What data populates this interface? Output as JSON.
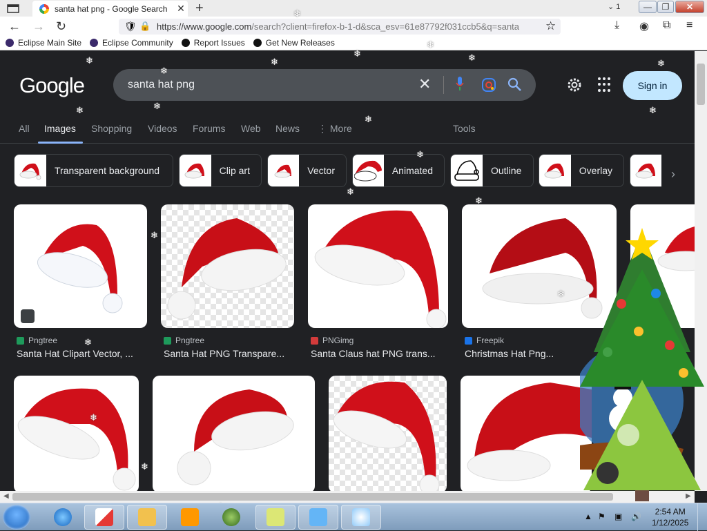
{
  "browser": {
    "tab_title": "santa hat png - Google Search",
    "tab_close": "✕",
    "new_tab": "+",
    "tab_count": "1",
    "url_prefix": "https://www.google.com",
    "url_rest": "/search?client=firefox-b-1-d&sca_esv=61e87792f031ccb5&q=santa",
    "window_buttons": [
      "—",
      "❐",
      "✕"
    ]
  },
  "bookmarks": [
    {
      "label": "Eclipse Main Site",
      "color": "#3b2a6b"
    },
    {
      "label": "Eclipse Community",
      "color": "#3b2a6b"
    },
    {
      "label": "Report Issues",
      "color": "#111111"
    },
    {
      "label": "Get New Releases",
      "color": "#111111"
    }
  ],
  "google": {
    "logo": "Google",
    "query": "santa hat png",
    "sign_in": "Sign in",
    "tabs": [
      "All",
      "Images",
      "Shopping",
      "Videos",
      "Forums",
      "Web",
      "News",
      "⋮ More",
      "Tools"
    ],
    "active_tab": "Images",
    "chips": [
      "Transparent background",
      "Clip art",
      "Vector",
      "Animated",
      "Outline",
      "Overlay"
    ],
    "results": [
      {
        "source": "Pngtree",
        "title": "Santa Hat Clipart Vector, ...",
        "fav": "#1e9a5b"
      },
      {
        "source": "Pngtree",
        "title": "Santa Hat PNG Transpare...",
        "fav": "#1e9a5b"
      },
      {
        "source": "PNGimg",
        "title": "Santa Claus hat PNG trans...",
        "fav": "#d33b3b"
      },
      {
        "source": "Freepik",
        "title": "Christmas Hat Png...",
        "fav": "#1a73e8"
      }
    ]
  },
  "taskbar": {
    "time": "2:54 AM",
    "date": "1/12/2025"
  },
  "colors": {
    "accent": "#8ab4f8",
    "signin_bg": "#c2e7ff",
    "hat_red": "#d0101a",
    "page_bg": "#202124"
  }
}
